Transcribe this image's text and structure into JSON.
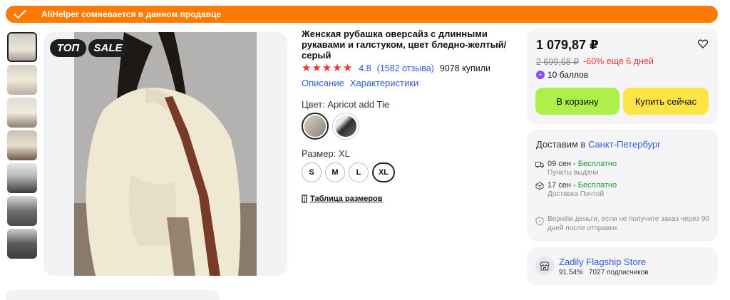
{
  "banner": {
    "text": "AliHelper сомневается в данном продавце",
    "color": "#ff7a00",
    "icon": "check-icon"
  },
  "gallery": {
    "badges": [
      "ТОП",
      "SALE"
    ],
    "thumbnail_count": 7,
    "selected_index": 0
  },
  "product": {
    "title": "Женская рубашка оверсайз с длинными рукавами и галстуком, цвет бледно-желтый/серый",
    "rating": {
      "stars": 5,
      "score": "4.8",
      "reviews": "(1582 отзыва)",
      "purchases": "9078 купили"
    },
    "tabs": [
      "Описание",
      "Характеристики"
    ],
    "color_label": "Цвет: Apricot add Tie",
    "color_swatches": [
      {
        "name": "apricot",
        "selected": true,
        "color": "#cfc7b8"
      },
      {
        "name": "grey",
        "selected": false,
        "color": "#3a3a3a"
      }
    ],
    "size_label": "Размер: XL",
    "sizes": [
      {
        "label": "S",
        "selected": false
      },
      {
        "label": "M",
        "selected": false
      },
      {
        "label": "L",
        "selected": false
      },
      {
        "label": "XL",
        "selected": true
      }
    ],
    "size_table_link": "Таблица размеров"
  },
  "price_panel": {
    "price": "1 079,87 ₽",
    "old_price": "2 699,68 ₽",
    "discount": "-60% еще 6 дней",
    "points": "10 баллов",
    "cart_button": "В корзину",
    "buy_button": "Купить сейчас",
    "favorite_icon": "heart-icon",
    "colors": {
      "cart": "#aef04a",
      "buy": "#ffe446",
      "discount": "#f23035"
    }
  },
  "delivery": {
    "prefix": "Доставим в",
    "city": "Санкт-Петербург",
    "options": [
      {
        "date": "09 сен",
        "sep": " - ",
        "price": "Бесплатно",
        "method": "Пункты выдачи",
        "icon": "truck-icon"
      },
      {
        "date": "17 сен",
        "sep": " - ",
        "price": "Бесплатно",
        "method": "Доставка Почтой",
        "icon": "box-icon"
      }
    ],
    "refund": "Вернём деньги, если не получите заказ через 90 дней после отправки.",
    "refund_icon": "shield-icon"
  },
  "store": {
    "name": "Zadily Flagship Store",
    "rating": "91.54%",
    "subscribers": "7027 подписчиков",
    "icon": "store-icon"
  }
}
